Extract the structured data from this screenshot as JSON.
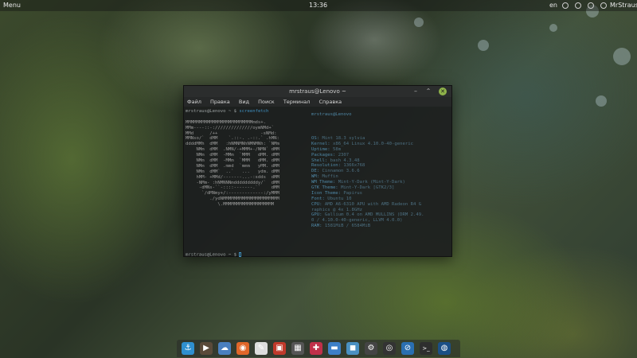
{
  "top_panel": {
    "menu_label": "Menu",
    "clock": "13:36",
    "language": "en",
    "user_name": "MrStraus"
  },
  "terminal": {
    "title": "mrstraus@Lenovo ~",
    "menu": [
      "Файл",
      "Правка",
      "Вид",
      "Поиск",
      "Терминал",
      "Справка"
    ],
    "prompt": "mrstraus@Lenovo ~ $",
    "command": "screenfetch",
    "user_host": "mrstraus@Lenovo",
    "art_lines": [
      "",
      "MMMMMMMMMMMMMMMMMMMMMMMMMmds+.",
      "MMm----::-://////////////oymNMd+`",
      "MMd      /++                -sNMd:",
      "MMNso/`  dMM    `.::-. .-::.` .hMN:",
      "ddddMMh  dMM   :hNMNMNhNMNMNh: `NMm",
      "    NMm  dMM  .NMN/-+MMM+-/NMN` dMM",
      "    NMm  dMM  -MMm  `MMM   dMM. dMM",
      "    NMm  dMM  -MMm  `MMM   dMM. dMM",
      "    NMm  dMM  .mmd  `mmm   yMM. dMM",
      "    NMm  dMM`  ..`   ...   ydm. dMM",
      "    hMM- +MMd/-------...-:sdds  dMM",
      "    -NMm- :hNMNNNmdddddddddy/`  dMM",
      "     -dMNs-``-::::-------.``    dMM",
      "      `/dMNmy+/:-------------:/yMMM",
      "         ./ydNMMMMMMMMMMMMMMMMMMMMM",
      "            \\.MMMMMMMMMMMMMMMMMMM"
    ],
    "info": [
      {
        "key": "OS:",
        "value": "Mint 18.3 sylvia"
      },
      {
        "key": "Kernel:",
        "value": "x86_64 Linux 4.10.0-40-generic"
      },
      {
        "key": "Uptime:",
        "value": "58m"
      },
      {
        "key": "Packages:",
        "value": "2307"
      },
      {
        "key": "Shell:",
        "value": "bash 4.3.48"
      },
      {
        "key": "Resolution:",
        "value": "1366x768"
      },
      {
        "key": "DE:",
        "value": "Cinnamon 3.6.6"
      },
      {
        "key": "WM:",
        "value": "Muffin"
      },
      {
        "key": "WM Theme:",
        "value": "Mint-Y-Dark (Mint-Y-Dark)"
      },
      {
        "key": "GTK Theme:",
        "value": "Mint-Y-Dark [GTK2/3]"
      },
      {
        "key": "Icon Theme:",
        "value": "Papirus"
      },
      {
        "key": "Font:",
        "value": "Ubuntu 10"
      },
      {
        "key": "CPU:",
        "value": "AMD A6-6310 APU with AMD Radeon R4 G"
      },
      {
        "key": "",
        "value": "raphics @ 4x 1.8GHz"
      },
      {
        "key": "GPU:",
        "value": "Gallium 0.4 on AMD MULLINS (DRM 2.49."
      },
      {
        "key": "",
        "value": "0 / 4.10.0-40-generic, LLVM 4.0.0)"
      },
      {
        "key": "RAM:",
        "value": "1581MiB / 6584MiB"
      }
    ]
  },
  "dock": [
    {
      "name": "anchor-icon",
      "glyph": "⚓",
      "color": "#2f8fcf"
    },
    {
      "name": "media-player-icon",
      "glyph": "▶",
      "color": "#5a4a3a"
    },
    {
      "name": "weather-icon",
      "glyph": "☁",
      "color": "#4a7fbf"
    },
    {
      "name": "firefox-icon",
      "glyph": "◉",
      "color": "#e0662a"
    },
    {
      "name": "text-editor-icon",
      "glyph": "✎",
      "color": "#dddddd"
    },
    {
      "name": "image-viewer-icon",
      "glyph": "▣",
      "color": "#c0392b"
    },
    {
      "name": "calculator-icon",
      "glyph": "▦",
      "color": "#555555"
    },
    {
      "name": "game-icon",
      "glyph": "✚",
      "color": "#c0304a"
    },
    {
      "name": "files-icon",
      "glyph": "▬",
      "color": "#3d7fc7"
    },
    {
      "name": "software-store-icon",
      "glyph": "◼",
      "color": "#4a90c2"
    },
    {
      "name": "settings-icon",
      "glyph": "⚙",
      "color": "#444444"
    },
    {
      "name": "goggles-icon",
      "glyph": "◎",
      "color": "#333333"
    },
    {
      "name": "blocked-icon",
      "glyph": "⊘",
      "color": "#2a6fb0"
    },
    {
      "name": "terminal-icon",
      "glyph": ">_",
      "color": "#2e2e2e"
    },
    {
      "name": "steam-icon",
      "glyph": "◍",
      "color": "#1b4f86"
    }
  ]
}
